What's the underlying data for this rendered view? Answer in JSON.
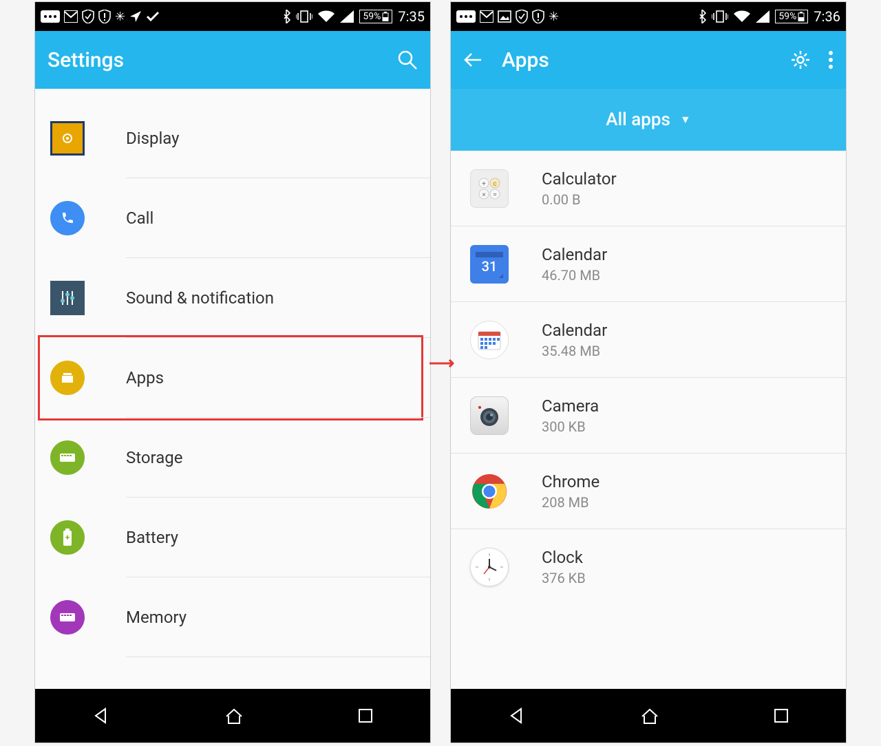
{
  "left": {
    "status": {
      "battery": "59%",
      "time": "7:35"
    },
    "title": "Settings",
    "items": [
      {
        "label": "Display"
      },
      {
        "label": "Call"
      },
      {
        "label": "Sound & notification"
      },
      {
        "label": "Apps",
        "highlighted": true
      },
      {
        "label": "Storage"
      },
      {
        "label": "Battery"
      },
      {
        "label": "Memory"
      }
    ]
  },
  "right": {
    "status": {
      "battery": "59%",
      "time": "7:36"
    },
    "title": "Apps",
    "filter": "All apps",
    "apps": [
      {
        "name": "Calculator",
        "size": "0.00 B"
      },
      {
        "name": "Calendar",
        "size": "46.70 MB"
      },
      {
        "name": "Calendar",
        "size": "35.48 MB"
      },
      {
        "name": "Camera",
        "size": "300 KB"
      },
      {
        "name": "Chrome",
        "size": "208 MB"
      },
      {
        "name": "Clock",
        "size": "376 KB"
      }
    ]
  },
  "arrow_glyph": "⟶"
}
